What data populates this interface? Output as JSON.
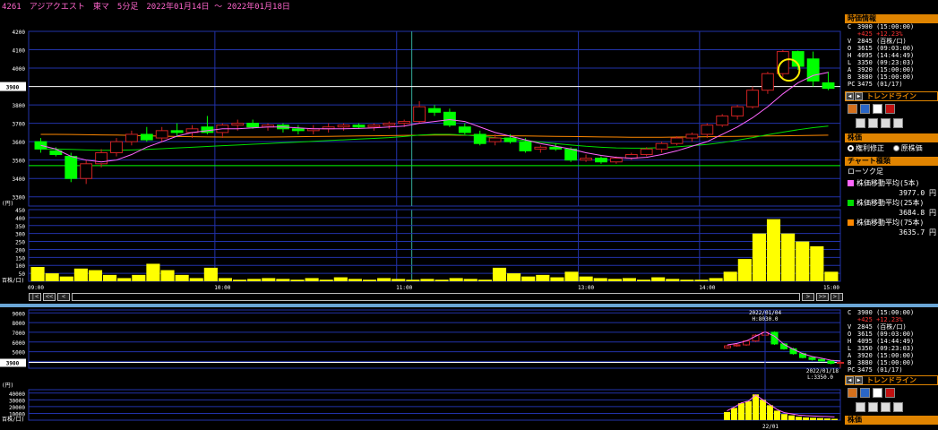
{
  "window": {
    "code": "4261",
    "name": "アジアクエスト",
    "market": "東マ",
    "period": "5分足",
    "range": "2022年01月14日 〜 2022年01月18日"
  },
  "colors": {
    "up_candle": "#000000",
    "down_candle": "#00ff00",
    "ma5": "#ff66ff",
    "ma25": "#00dd00",
    "ma75": "#ff8800",
    "volume": "#ffff00",
    "grid": "#2233aa",
    "accent": "#e08400",
    "highlight": "#ffee00"
  },
  "main_chart": {
    "y_ticks": [
      "4200",
      "4100",
      "4000",
      "3900",
      "3800",
      "3700",
      "3600",
      "3500",
      "3400",
      "3300"
    ],
    "price_label": "3900",
    "x_ticks": [
      "09:00",
      "10:00",
      "11:00",
      "13:00",
      "14:00",
      "15:00"
    ],
    "vol_unit": "(円)",
    "vol_ticks": [
      "450",
      "400",
      "350",
      "300",
      "250",
      "200",
      "150",
      "100",
      "50"
    ],
    "vol_unit_label": "百株/口)",
    "candles": [
      [
        3600,
        3620,
        3540,
        3560
      ],
      [
        3550,
        3570,
        3520,
        3530
      ],
      [
        3520,
        3540,
        3380,
        3400
      ],
      [
        3400,
        3500,
        3370,
        3480
      ],
      [
        3480,
        3560,
        3460,
        3540
      ],
      [
        3540,
        3620,
        3520,
        3600
      ],
      [
        3600,
        3660,
        3580,
        3640
      ],
      [
        3640,
        3680,
        3600,
        3610
      ],
      [
        3620,
        3680,
        3600,
        3660
      ],
      [
        3660,
        3700,
        3630,
        3650
      ],
      [
        3650,
        3690,
        3620,
        3670
      ],
      [
        3680,
        3740,
        3640,
        3650
      ],
      [
        3650,
        3700,
        3620,
        3690
      ],
      [
        3690,
        3720,
        3660,
        3700
      ],
      [
        3700,
        3720,
        3670,
        3680
      ],
      [
        3680,
        3700,
        3660,
        3690
      ],
      [
        3690,
        3700,
        3650,
        3670
      ],
      [
        3670,
        3690,
        3640,
        3660
      ],
      [
        3660,
        3690,
        3640,
        3670
      ],
      [
        3670,
        3700,
        3650,
        3680
      ],
      [
        3680,
        3700,
        3660,
        3690
      ],
      [
        3690,
        3700,
        3670,
        3680
      ],
      [
        3680,
        3700,
        3660,
        3690
      ],
      [
        3690,
        3710,
        3670,
        3700
      ],
      [
        3700,
        3720,
        3680,
        3710
      ],
      [
        3710,
        3820,
        3700,
        3790
      ],
      [
        3780,
        3800,
        3740,
        3760
      ],
      [
        3760,
        3780,
        3680,
        3690
      ],
      [
        3680,
        3700,
        3640,
        3650
      ],
      [
        3640,
        3660,
        3580,
        3590
      ],
      [
        3600,
        3640,
        3580,
        3620
      ],
      [
        3620,
        3640,
        3590,
        3600
      ],
      [
        3600,
        3620,
        3540,
        3550
      ],
      [
        3560,
        3580,
        3540,
        3570
      ],
      [
        3570,
        3590,
        3550,
        3560
      ],
      [
        3560,
        3570,
        3490,
        3500
      ],
      [
        3500,
        3530,
        3490,
        3510
      ],
      [
        3510,
        3520,
        3480,
        3490
      ],
      [
        3490,
        3520,
        3480,
        3510
      ],
      [
        3510,
        3540,
        3500,
        3530
      ],
      [
        3530,
        3570,
        3520,
        3560
      ],
      [
        3560,
        3600,
        3540,
        3590
      ],
      [
        3590,
        3630,
        3580,
        3620
      ],
      [
        3620,
        3650,
        3600,
        3640
      ],
      [
        3640,
        3700,
        3620,
        3690
      ],
      [
        3690,
        3750,
        3680,
        3740
      ],
      [
        3740,
        3800,
        3720,
        3790
      ],
      [
        3790,
        3900,
        3780,
        3880
      ],
      [
        3880,
        3980,
        3860,
        3970
      ],
      [
        3970,
        4100,
        3950,
        4090
      ],
      [
        4090,
        4095,
        3990,
        4010
      ],
      [
        4050,
        4090,
        3900,
        3930
      ],
      [
        3920,
        3980,
        3880,
        3890
      ]
    ],
    "ma5": [
      3580,
      3560,
      3520,
      3500,
      3490,
      3500,
      3530,
      3570,
      3600,
      3630,
      3650,
      3660,
      3670,
      3670,
      3675,
      3680,
      3680,
      3675,
      3670,
      3670,
      3670,
      3672,
      3675,
      3680,
      3685,
      3700,
      3710,
      3720,
      3710,
      3680,
      3650,
      3630,
      3610,
      3590,
      3575,
      3560,
      3540,
      3525,
      3515,
      3510,
      3515,
      3530,
      3550,
      3575,
      3600,
      3640,
      3680,
      3730,
      3790,
      3860,
      3920,
      3960,
      3977
    ],
    "ma25": [
      3560,
      3560,
      3558,
      3555,
      3553,
      3553,
      3555,
      3558,
      3562,
      3566,
      3570,
      3574,
      3578,
      3582,
      3586,
      3590,
      3594,
      3598,
      3602,
      3606,
      3610,
      3614,
      3618,
      3622,
      3628,
      3636,
      3640,
      3640,
      3636,
      3630,
      3622,
      3614,
      3606,
      3598,
      3590,
      3582,
      3575,
      3570,
      3566,
      3565,
      3565,
      3568,
      3572,
      3578,
      3585,
      3595,
      3608,
      3622,
      3638,
      3652,
      3665,
      3676,
      3684.8
    ],
    "ma75": [
      3640,
      3640,
      3639,
      3638,
      3637,
      3636,
      3634,
      3632,
      3630,
      3628,
      3627,
      3626,
      3625,
      3625,
      3625,
      3625,
      3626,
      3627,
      3628,
      3629,
      3630,
      3631,
      3632,
      3633,
      3634,
      3635,
      3636,
      3636,
      3635,
      3634,
      3633,
      3632,
      3631,
      3630,
      3629,
      3628,
      3627,
      3626,
      3625,
      3624,
      3624,
      3624,
      3625,
      3626,
      3627,
      3628,
      3629,
      3630,
      3631,
      3632,
      3633,
      3634,
      3635.7
    ],
    "volumes": [
      90,
      50,
      30,
      80,
      70,
      40,
      20,
      40,
      110,
      70,
      40,
      20,
      85,
      20,
      10,
      15,
      20,
      15,
      10,
      20,
      10,
      25,
      15,
      10,
      20,
      15,
      10,
      15,
      10,
      20,
      15,
      10,
      85,
      50,
      30,
      40,
      25,
      60,
      30,
      20,
      15,
      20,
      10,
      25,
      15,
      10,
      10,
      20,
      60,
      140,
      300,
      390,
      300,
      250,
      220,
      60
    ]
  },
  "hline_green": "3470",
  "hline_white": "3900",
  "nav": {
    "first": "|<",
    "prev2": "<<",
    "prev": "<",
    "next": ">",
    "next2": ">>",
    "last": ">|"
  },
  "sub_chart": {
    "y_ticks": [
      "9000",
      "8000",
      "7000",
      "6000",
      "5000",
      "4000",
      "3900"
    ],
    "high_date": "2022/01/04",
    "high_label": "H:8030.0",
    "low_date": "2022/01/18",
    "low_label": "L:3350.0",
    "vol_unit": "(円)",
    "vol_ticks": [
      "40000",
      "30000",
      "20000",
      "10000"
    ],
    "vol_unit_label": "百株/口)",
    "x_tick": "22/01"
  },
  "side": {
    "quote_header": "時価情報",
    "quotes": [
      {
        "k": "C",
        "v": "3900 (15:00:00)",
        "red": false
      },
      {
        "k": "",
        "v": "+425 +12.23%",
        "red": true
      },
      {
        "k": "V",
        "v": "2845 (百株/口)",
        "red": false
      },
      {
        "k": "O",
        "v": "3615 (09:03:00)",
        "red": false
      },
      {
        "k": "H",
        "v": "4095 (14:44:49)",
        "red": false
      },
      {
        "k": "L",
        "v": "3350 (09:23:03)",
        "red": false
      },
      {
        "k": "A",
        "v": "3920 (15:00:00)",
        "red": false
      },
      {
        "k": "B",
        "v": "3880 (15:00:00)",
        "red": false
      },
      {
        "k": "PC",
        "v": "3475 (01/17)",
        "red": false
      }
    ],
    "trendline": "トレンドライン",
    "stock_header": "株価",
    "radio1": "権利修正",
    "radio2": "原株価",
    "chart_type_header": "チャート種類",
    "candle_label": "ローソク足",
    "ma5_label": "株価移動平均(5本)",
    "ma5_value": "3977.0 円",
    "ma25_label": "株価移動平均(25本)",
    "ma25_value": "3684.8 円",
    "ma75_label": "株価移動平均(75本)",
    "ma75_value": "3635.7 円",
    "stock_footer": "株価"
  }
}
